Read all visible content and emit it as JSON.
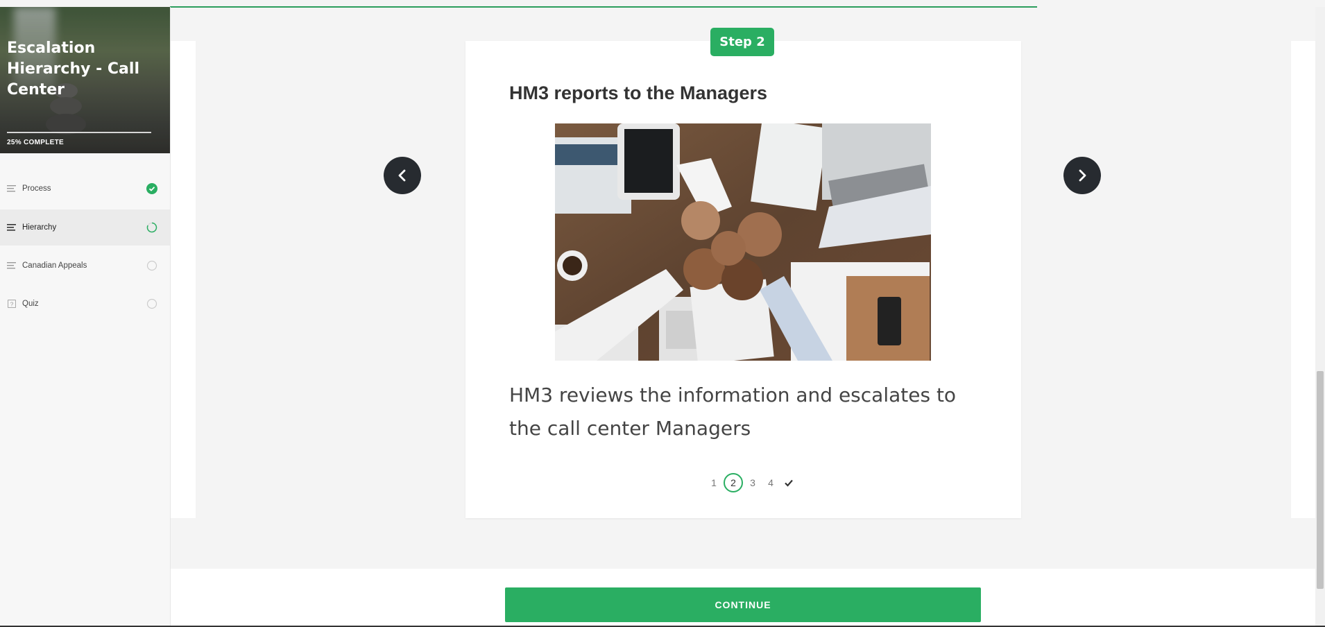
{
  "course": {
    "title": "Escalation Hierarchy - Call Center",
    "progress_label": "25% COMPLETE",
    "progress_fraction": 0.25
  },
  "sidebar": {
    "items": [
      {
        "label": "Process",
        "icon": "lines-icon",
        "status": "complete"
      },
      {
        "label": "Hierarchy",
        "icon": "lines-icon",
        "status": "in-progress"
      },
      {
        "label": "Canadian Appeals",
        "icon": "lines-icon",
        "status": "not-started"
      },
      {
        "label": "Quiz",
        "icon": "question-box-icon",
        "status": "not-started"
      }
    ]
  },
  "step": {
    "badge": "Step 2",
    "title": "HM3 reports to the Managers",
    "image_alt": "fist-bump-teamwork-photo",
    "body": "HM3 reviews the information and escalates to the call center Managers"
  },
  "pager": {
    "pages": [
      "1",
      "2",
      "3",
      "4"
    ],
    "current": "2",
    "done_icon": "check-icon"
  },
  "footer": {
    "continue_label": "CONTINUE"
  },
  "colors": {
    "accent": "#2aae62",
    "dark_button": "#272b30"
  }
}
